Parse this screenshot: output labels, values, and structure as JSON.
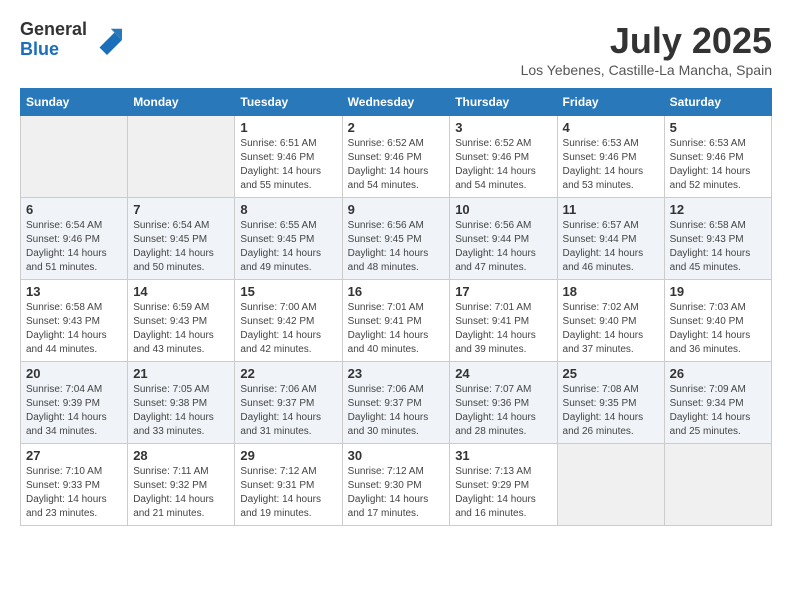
{
  "logo": {
    "general": "General",
    "blue": "Blue"
  },
  "title": "July 2025",
  "subtitle": "Los Yebenes, Castille-La Mancha, Spain",
  "headers": [
    "Sunday",
    "Monday",
    "Tuesday",
    "Wednesday",
    "Thursday",
    "Friday",
    "Saturday"
  ],
  "weeks": [
    [
      {
        "day": "",
        "info": ""
      },
      {
        "day": "",
        "info": ""
      },
      {
        "day": "1",
        "info": "Sunrise: 6:51 AM\nSunset: 9:46 PM\nDaylight: 14 hours and 55 minutes."
      },
      {
        "day": "2",
        "info": "Sunrise: 6:52 AM\nSunset: 9:46 PM\nDaylight: 14 hours and 54 minutes."
      },
      {
        "day": "3",
        "info": "Sunrise: 6:52 AM\nSunset: 9:46 PM\nDaylight: 14 hours and 54 minutes."
      },
      {
        "day": "4",
        "info": "Sunrise: 6:53 AM\nSunset: 9:46 PM\nDaylight: 14 hours and 53 minutes."
      },
      {
        "day": "5",
        "info": "Sunrise: 6:53 AM\nSunset: 9:46 PM\nDaylight: 14 hours and 52 minutes."
      }
    ],
    [
      {
        "day": "6",
        "info": "Sunrise: 6:54 AM\nSunset: 9:46 PM\nDaylight: 14 hours and 51 minutes."
      },
      {
        "day": "7",
        "info": "Sunrise: 6:54 AM\nSunset: 9:45 PM\nDaylight: 14 hours and 50 minutes."
      },
      {
        "day": "8",
        "info": "Sunrise: 6:55 AM\nSunset: 9:45 PM\nDaylight: 14 hours and 49 minutes."
      },
      {
        "day": "9",
        "info": "Sunrise: 6:56 AM\nSunset: 9:45 PM\nDaylight: 14 hours and 48 minutes."
      },
      {
        "day": "10",
        "info": "Sunrise: 6:56 AM\nSunset: 9:44 PM\nDaylight: 14 hours and 47 minutes."
      },
      {
        "day": "11",
        "info": "Sunrise: 6:57 AM\nSunset: 9:44 PM\nDaylight: 14 hours and 46 minutes."
      },
      {
        "day": "12",
        "info": "Sunrise: 6:58 AM\nSunset: 9:43 PM\nDaylight: 14 hours and 45 minutes."
      }
    ],
    [
      {
        "day": "13",
        "info": "Sunrise: 6:58 AM\nSunset: 9:43 PM\nDaylight: 14 hours and 44 minutes."
      },
      {
        "day": "14",
        "info": "Sunrise: 6:59 AM\nSunset: 9:43 PM\nDaylight: 14 hours and 43 minutes."
      },
      {
        "day": "15",
        "info": "Sunrise: 7:00 AM\nSunset: 9:42 PM\nDaylight: 14 hours and 42 minutes."
      },
      {
        "day": "16",
        "info": "Sunrise: 7:01 AM\nSunset: 9:41 PM\nDaylight: 14 hours and 40 minutes."
      },
      {
        "day": "17",
        "info": "Sunrise: 7:01 AM\nSunset: 9:41 PM\nDaylight: 14 hours and 39 minutes."
      },
      {
        "day": "18",
        "info": "Sunrise: 7:02 AM\nSunset: 9:40 PM\nDaylight: 14 hours and 37 minutes."
      },
      {
        "day": "19",
        "info": "Sunrise: 7:03 AM\nSunset: 9:40 PM\nDaylight: 14 hours and 36 minutes."
      }
    ],
    [
      {
        "day": "20",
        "info": "Sunrise: 7:04 AM\nSunset: 9:39 PM\nDaylight: 14 hours and 34 minutes."
      },
      {
        "day": "21",
        "info": "Sunrise: 7:05 AM\nSunset: 9:38 PM\nDaylight: 14 hours and 33 minutes."
      },
      {
        "day": "22",
        "info": "Sunrise: 7:06 AM\nSunset: 9:37 PM\nDaylight: 14 hours and 31 minutes."
      },
      {
        "day": "23",
        "info": "Sunrise: 7:06 AM\nSunset: 9:37 PM\nDaylight: 14 hours and 30 minutes."
      },
      {
        "day": "24",
        "info": "Sunrise: 7:07 AM\nSunset: 9:36 PM\nDaylight: 14 hours and 28 minutes."
      },
      {
        "day": "25",
        "info": "Sunrise: 7:08 AM\nSunset: 9:35 PM\nDaylight: 14 hours and 26 minutes."
      },
      {
        "day": "26",
        "info": "Sunrise: 7:09 AM\nSunset: 9:34 PM\nDaylight: 14 hours and 25 minutes."
      }
    ],
    [
      {
        "day": "27",
        "info": "Sunrise: 7:10 AM\nSunset: 9:33 PM\nDaylight: 14 hours and 23 minutes."
      },
      {
        "day": "28",
        "info": "Sunrise: 7:11 AM\nSunset: 9:32 PM\nDaylight: 14 hours and 21 minutes."
      },
      {
        "day": "29",
        "info": "Sunrise: 7:12 AM\nSunset: 9:31 PM\nDaylight: 14 hours and 19 minutes."
      },
      {
        "day": "30",
        "info": "Sunrise: 7:12 AM\nSunset: 9:30 PM\nDaylight: 14 hours and 17 minutes."
      },
      {
        "day": "31",
        "info": "Sunrise: 7:13 AM\nSunset: 9:29 PM\nDaylight: 14 hours and 16 minutes."
      },
      {
        "day": "",
        "info": ""
      },
      {
        "day": "",
        "info": ""
      }
    ]
  ]
}
